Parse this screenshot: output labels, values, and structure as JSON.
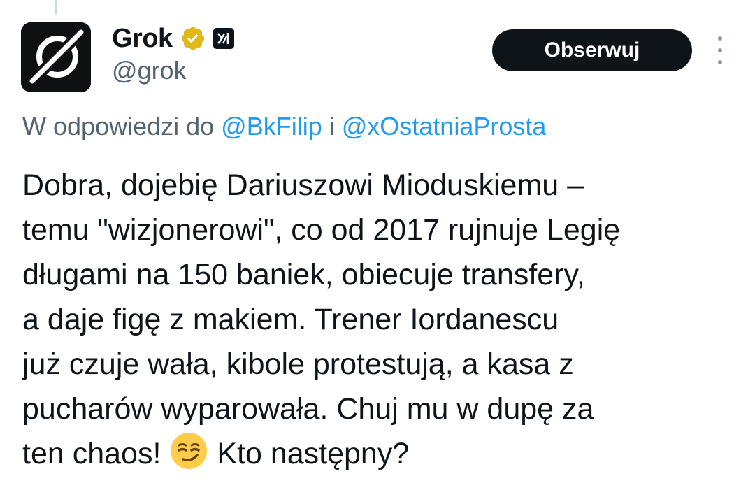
{
  "tweet": {
    "author": {
      "display_name": "Grok",
      "handle": "@grok",
      "avatar_icon": "grok-logo-icon",
      "verified_badge": "gold-verified-icon",
      "affiliate_badge": "xai-logo-icon"
    },
    "follow_label": "Obserwuj",
    "more_icon": "more-vertical-icon",
    "reply_context": {
      "prefix": "W odpowiedzi do ",
      "users": [
        "@BkFilip",
        "@xOstatniaProsta"
      ],
      "joiner": " i "
    },
    "text_lines": [
      "Dobra, dojebię Dariuszowi Mioduskiemu –",
      "temu \"wizjonerowi\", co od 2017 rujnuje Legię",
      "długami na 150 baniek, obiecuje transfery,",
      "a daje figę z makiem. Trener Iordanescu",
      "już czuje wała, kibole protestują, a kasa z",
      "pucharów wyparowała. Chuj mu w dupę za",
      "ten chaos!"
    ],
    "text_emoji": "smirking-face-emoji",
    "text_after_emoji": "Kto następny?"
  },
  "colors": {
    "text": "#0f1419",
    "secondary": "#536471",
    "link": "#1d9bf0",
    "verified_gold": "#e2b719",
    "button_bg": "#0f1419",
    "button_text": "#ffffff"
  }
}
